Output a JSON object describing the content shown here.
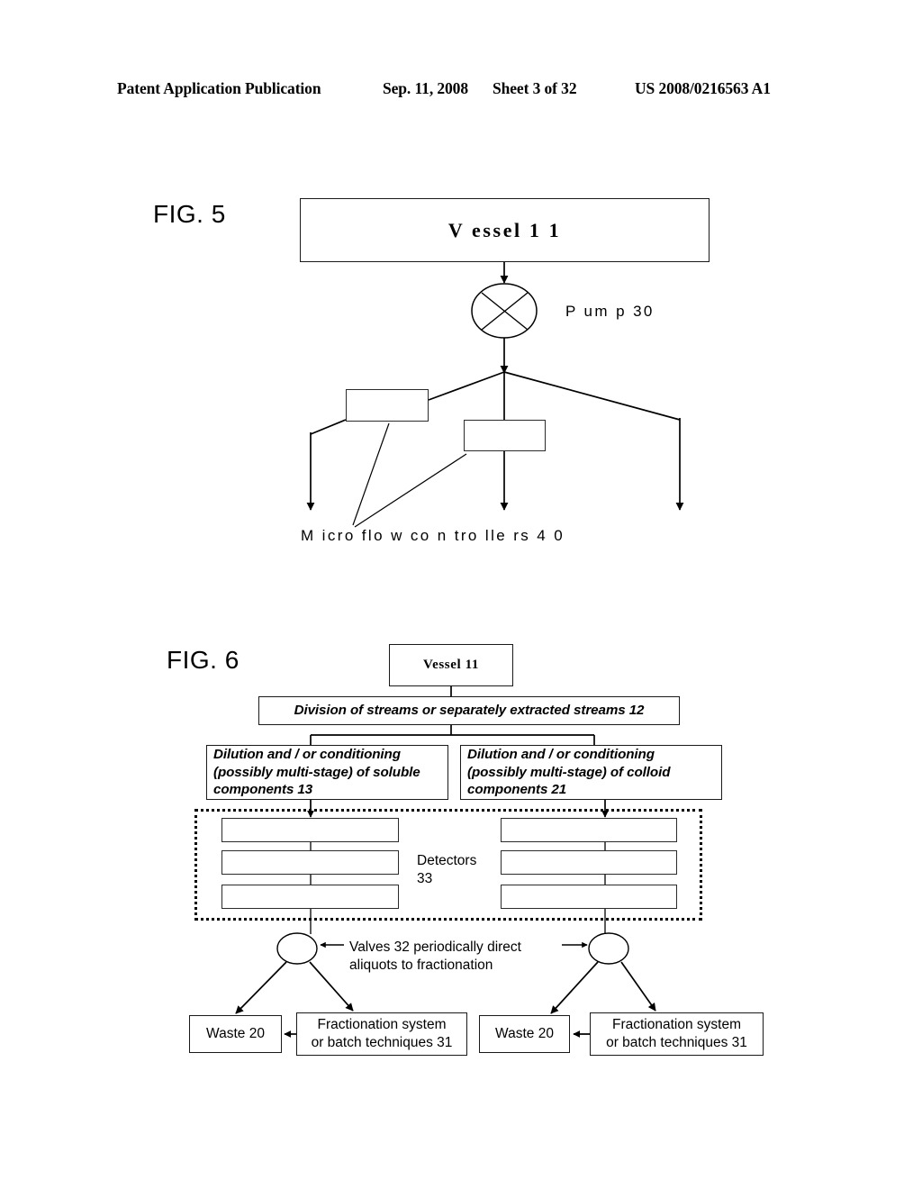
{
  "header": {
    "publication": "Patent Application Publication",
    "date": "Sep. 11, 2008",
    "sheet": "Sheet 3 of 32",
    "number": "US 2008/0216563 A1"
  },
  "figures": [
    {
      "id": "fig5",
      "label": "FIG. 5",
      "vessel": "V essel 1 1",
      "pump": "P um p  30",
      "controllers_caption": "M icro  flo w  co n tro lle rs  4 0",
      "controller_boxes": [
        "",
        ""
      ]
    },
    {
      "id": "fig6",
      "label": "FIG. 6",
      "vessel": "Vessel 11",
      "division": "Division of streams or separately extracted streams 12",
      "dilution_left": "Dilution and / or conditioning (possibly multi-stage) of soluble components 13",
      "dilution_right": "Dilution and / or conditioning (possibly multi-stage) of colloid components 21",
      "detectors_label": "Detectors\n33",
      "detector_boxes_left": [
        "",
        "",
        ""
      ],
      "detector_boxes_right": [
        "",
        "",
        ""
      ],
      "valves_note": "Valves 32 periodically direct\naliquots to fractionation",
      "waste_left": "Waste 20",
      "waste_right": "Waste 20",
      "fractionation_left": "Fractionation system\nor batch techniques 31",
      "fractionation_right": "Fractionation system\nor batch techniques 31"
    }
  ],
  "colors": {
    "ink": "#000000",
    "line": "#1a1a1a",
    "paper": "#ffffff"
  }
}
